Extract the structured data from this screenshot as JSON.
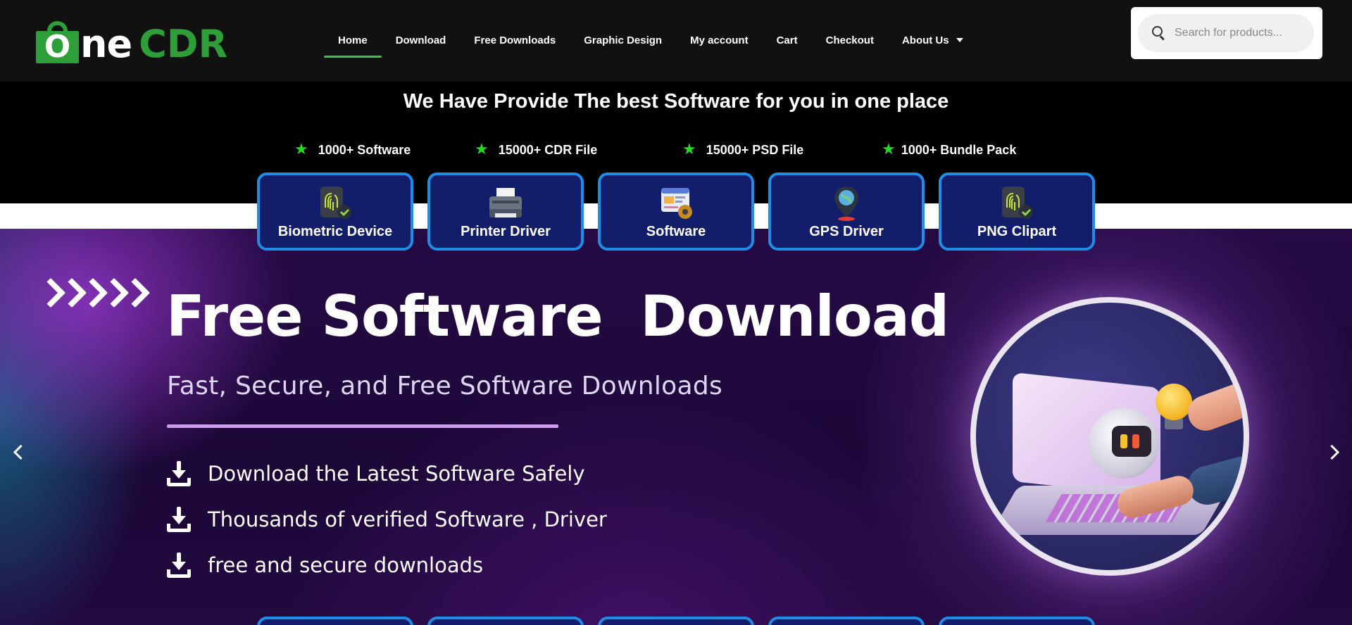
{
  "brand": {
    "logo_letter": "O",
    "logo_text_white": "ne",
    "logo_text_green": "CDR",
    "accent_green": "#2e9e38"
  },
  "nav": {
    "items": [
      {
        "label": "Home",
        "active": true
      },
      {
        "label": "Download"
      },
      {
        "label": "Free Downloads"
      },
      {
        "label": "Graphic Design"
      },
      {
        "label": "My account"
      },
      {
        "label": "Cart"
      },
      {
        "label": "Checkout"
      },
      {
        "label": "About Us",
        "has_dropdown": true
      }
    ]
  },
  "search": {
    "placeholder": "Search for products...",
    "icon": "search-icon"
  },
  "band": {
    "title": "We Have Provide The best Software for you in one place",
    "stats": [
      {
        "label": "1000+ Software",
        "icon": "star-icon"
      },
      {
        "label": "15000+ CDR File",
        "icon": "star-icon"
      },
      {
        "label": "15000+ PSD File",
        "icon": "star-icon"
      },
      {
        "label": "1000+ Bundle Pack",
        "icon": "star-icon"
      }
    ]
  },
  "categories": [
    {
      "label": "Biometric Device",
      "icon": "fingerprint-icon"
    },
    {
      "label": "Printer Driver",
      "icon": "printer-icon"
    },
    {
      "label": "Software",
      "icon": "software-gear-icon"
    },
    {
      "label": "GPS Driver",
      "icon": "gps-pin-icon"
    },
    {
      "label": "PNG Clipart",
      "icon": "fingerprint-icon"
    }
  ],
  "hero": {
    "title": "Free Software  Download",
    "subtitle": "Fast, Secure, and Free Software Downloads",
    "features": [
      {
        "text": "Download the Latest Software Safely",
        "icon": "download-icon"
      },
      {
        "text": "Thousands of verified Software , Driver",
        "icon": "download-icon"
      },
      {
        "text": "free  and secure downloads",
        "icon": "download-icon"
      }
    ],
    "image_label": "robot-laptop-illustration"
  },
  "colors": {
    "card_bg": "#131e6a",
    "card_border": "#1f8de6",
    "star": "#22dd22",
    "hero_rule": "#cf9bf0"
  }
}
